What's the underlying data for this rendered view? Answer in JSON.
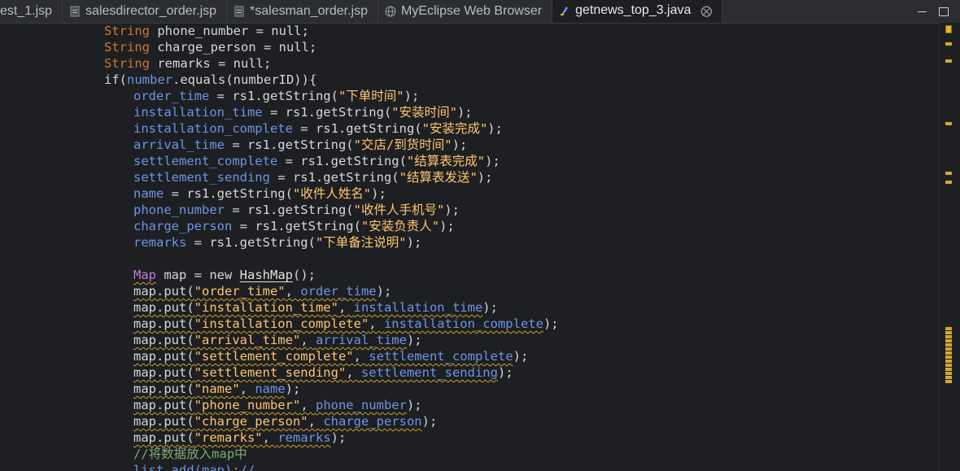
{
  "tabs": [
    {
      "label": "est_1.jsp",
      "icon": "jsp-file-icon",
      "active": false
    },
    {
      "label": "salesdirector_order.jsp",
      "icon": "jsp-file-icon",
      "active": false
    },
    {
      "label": "*salesman_order.jsp",
      "icon": "jsp-file-icon",
      "active": false
    },
    {
      "label": "MyEclipse Web Browser",
      "icon": "globe-icon",
      "active": false
    },
    {
      "label": "getnews_top_3.java",
      "icon": "java-file-icon",
      "active": true,
      "close": "⨂"
    }
  ],
  "code": {
    "decl1": {
      "kw": "String",
      "rest": " phone_number = null;"
    },
    "decl2": {
      "kw": "String",
      "rest": " charge_person = null;"
    },
    "decl3": {
      "kw": "String",
      "rest": " remarks = null;"
    },
    "if_kw": "if(",
    "if_number": "number",
    "if_rest": ".equals(numberID)){",
    "assign": [
      {
        "var": "order_time",
        "str": "\"下单时间\""
      },
      {
        "var": "installation_time",
        "str": "\"安装时间\""
      },
      {
        "var": "installation_complete",
        "str": "\"安装完成\""
      },
      {
        "var": "arrival_time",
        "str": "\"交店/到货时间\""
      },
      {
        "var": "settlement_complete",
        "str": "\"结算表完成\""
      },
      {
        "var": "settlement_sending",
        "str": "\"结算表发送\""
      },
      {
        "var": "name",
        "str": "\"收件人姓名\""
      },
      {
        "var": "phone_number",
        "str": "\"收件人手机号\""
      },
      {
        "var": "charge_person",
        "str": "\"安装负责人\""
      },
      {
        "var": "remarks",
        "str": "\"下单备注说明\""
      }
    ],
    "assign_mid": " = rs1.getString(",
    "assign_end": ");",
    "map_decl": {
      "type": "Map",
      "rest1": " map = ",
      "kw": "new",
      "cls": "HashMap",
      "rest2": "();"
    },
    "puts": [
      {
        "key": "\"order_time\"",
        "val": "order_time"
      },
      {
        "key": "\"installation_time\"",
        "val": "installation_time"
      },
      {
        "key": "\"installation_complete\"",
        "val": "installation_complete"
      },
      {
        "key": "\"arrival_time\"",
        "val": "arrival_time"
      },
      {
        "key": "\"settlement_complete\"",
        "val": "settlement_complete"
      },
      {
        "key": "\"settlement_sending\"",
        "val": "settlement_sending"
      },
      {
        "key": "\"name\"",
        "val": "name"
      },
      {
        "key": "\"phone_number\"",
        "val": "phone_number"
      },
      {
        "key": "\"charge_person\"",
        "val": "charge_person"
      },
      {
        "key": "\"remarks\"",
        "val": "remarks"
      }
    ],
    "put_prefix": "map.put(",
    "put_sep": ", ",
    "put_end": ");",
    "comment": "//将数据放入map中",
    "last_line": "list.add(map);//"
  },
  "colors": {
    "background": "#1e1f22",
    "keyword": "#cc7832",
    "variable": "#6c95e6",
    "string": "#ffc66d",
    "comment": "#7fa970",
    "warning_mark": "#d4a72c"
  }
}
